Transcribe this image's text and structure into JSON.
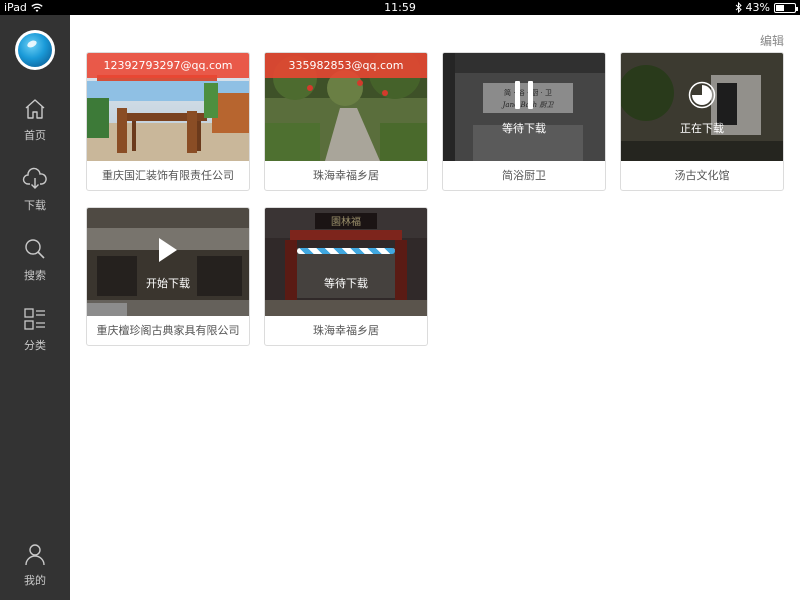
{
  "status_bar": {
    "device": "iPad",
    "time": "11:59",
    "battery": "43%",
    "battery_level": 0.43
  },
  "sidebar": {
    "items": [
      {
        "label": "首页",
        "icon": "home-icon"
      },
      {
        "label": "下载",
        "icon": "download-icon"
      },
      {
        "label": "搜索",
        "icon": "search-icon"
      },
      {
        "label": "分类",
        "icon": "category-icon"
      }
    ],
    "profile": {
      "label": "我的",
      "icon": "user-icon"
    }
  },
  "main": {
    "edit_label": "编辑",
    "cards": [
      {
        "caption": "重庆国汇装饰有限责任公司",
        "email": "12392793297@qq.com"
      },
      {
        "caption": "珠海幸福乡居",
        "email": "335982853@qq.com"
      },
      {
        "caption": "简浴厨卫",
        "status": "等待下载",
        "sign_line1": "简 · 浴 · 厨 · 卫",
        "sign_line2": "Jane Bath 厨卫"
      },
      {
        "caption": "汤古文化馆",
        "status": "正在下载",
        "progress": 0.75
      },
      {
        "caption": "重庆檀珍阁古典家具有限公司",
        "status": "开始下载"
      },
      {
        "caption": "珠海幸福乡居",
        "status": "等待下载",
        "sign": "園林福"
      }
    ]
  },
  "colors": {
    "sidebar_bg": "#333333",
    "accent": "#41a8e0",
    "email_banner": "#eb4632"
  }
}
